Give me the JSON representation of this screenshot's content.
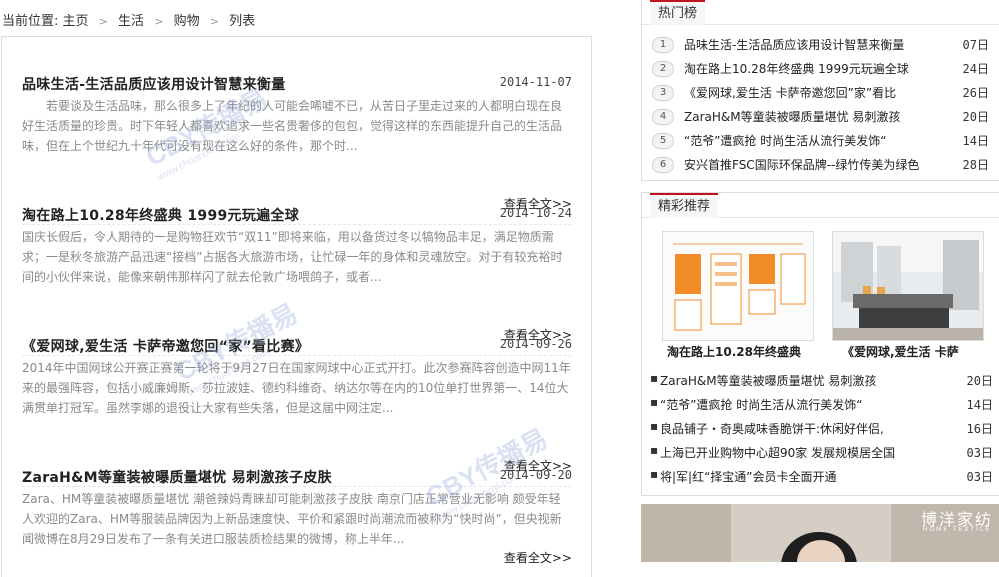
{
  "breadcrumb": {
    "prefix": "当前位置:",
    "items": [
      "主页",
      "生活",
      "购物",
      "列表"
    ]
  },
  "articles": [
    {
      "title": "品味生活-生活品质应该用设计智慧来衡量",
      "date": "2014-11-07",
      "summary": "若要谈及生活品味，那么很多上了年纪的人可能会唏嘘不已，从苦日子里走过来的人都明白现在良好生活质量的珍贵。时下年轻人都喜欢追求一些名贵奢侈的包包，觉得这样的东西能提升自己的生活品味，但在上个世纪九十年代可没有现在这么好的条件，那个时...",
      "more": "查看全文>>"
    },
    {
      "title": "淘在路上10.28年终盛典 1999元玩遍全球",
      "date": "2014-10-24",
      "summary": "国庆长假后，令人期待的一是购物狂欢节“双11”即将来临，用以备货过冬以犒物品丰足，满足物质需求；一是秋冬旅游产品迅速“接档”占据各大旅游市场，让忙碌一年的身体和灵魂放空。对于有较充裕时间的小伙伴来说，能像来朝伟那样闪了就去伦敦广场喂鸽子，或者...",
      "more": "查看全文>>"
    },
    {
      "title": "《爱网球,爱生活 卡萨帝邀您回“家”看比赛》",
      "date": "2014-09-26",
      "summary": "2014年中国网球公开赛正赛第一轮将于9月27日在国家网球中心正式开打。此次参赛阵容创造中网11年来的最强阵容，包括小威廉姆斯、莎拉波娃、德约科维奇、纳达尔等在内的10位单打世界第一、14位大满贯单打冠军。虽然李娜的退役让大家有些失落，但是这届中网注定...",
      "more": "查看全文>>"
    },
    {
      "title": "ZaraH&M等童装被曝质量堪忧 易刺激孩子皮肤",
      "date": "2014-09-20",
      "summary": "Zara、HM等童装被曝质量堪忧 潮爸辣妈青睐却可能刺激孩子皮肤 南京门店正常营业无影响 颇受年轻人欢迎的Zara、HM等服装品牌因为上新品速度快、平价和紧跟时尚潮流而被称为“快时尚”，但央视新闻微博在8月29日发布了一条有关进口服装质检结果的微博，称上半年...",
      "more": "查看全文>>"
    }
  ],
  "watermark": {
    "text": "CBY传播易",
    "sub": "www.chuanboyi.com"
  },
  "hot": {
    "title": "热门榜",
    "items": [
      {
        "num": "1",
        "text": "品味生活-生活品质应该用设计智慧来衡量",
        "date": "07日"
      },
      {
        "num": "2",
        "text": "淘在路上10.28年终盛典 1999元玩遍全球",
        "date": "24日"
      },
      {
        "num": "3",
        "text": "《爱网球,爱生活 卡萨帝邀您回”家”看比",
        "date": "26日"
      },
      {
        "num": "4",
        "text": "ZaraH&M等童装被曝质量堪忧 易刺激孩",
        "date": "20日"
      },
      {
        "num": "5",
        "text": "“范爷”遭疯抢 时尚生活从流行美发饰“",
        "date": "14日"
      },
      {
        "num": "6",
        "text": "安兴首推FSC国际环保品牌--绿竹传美为绿色",
        "date": "28日"
      }
    ]
  },
  "rec": {
    "title": "精彩推荐",
    "cards": [
      {
        "caption": "淘在路上10.28年终盛典"
      },
      {
        "caption": "《爱网球,爱生活 卡萨"
      }
    ],
    "items": [
      {
        "text": "ZaraH&M等童装被曝质量堪忧 易刺激孩",
        "date": "20日"
      },
      {
        "text": "“范爷”遭疯抢 时尚生活从流行美发饰“",
        "date": "14日"
      },
      {
        "text": "良品铺子・奇奥咸味香脆饼干:休闲好伴侣,",
        "date": "16日"
      },
      {
        "text": "上海已开业购物中心超90家 发展规模居全国",
        "date": "03日"
      },
      {
        "text": "将|军|红“择宝通”会员卡全面开通",
        "date": "03日"
      }
    ]
  },
  "banner": {
    "brand": "博洋家纺",
    "sub": "HOME TEXTILE"
  }
}
